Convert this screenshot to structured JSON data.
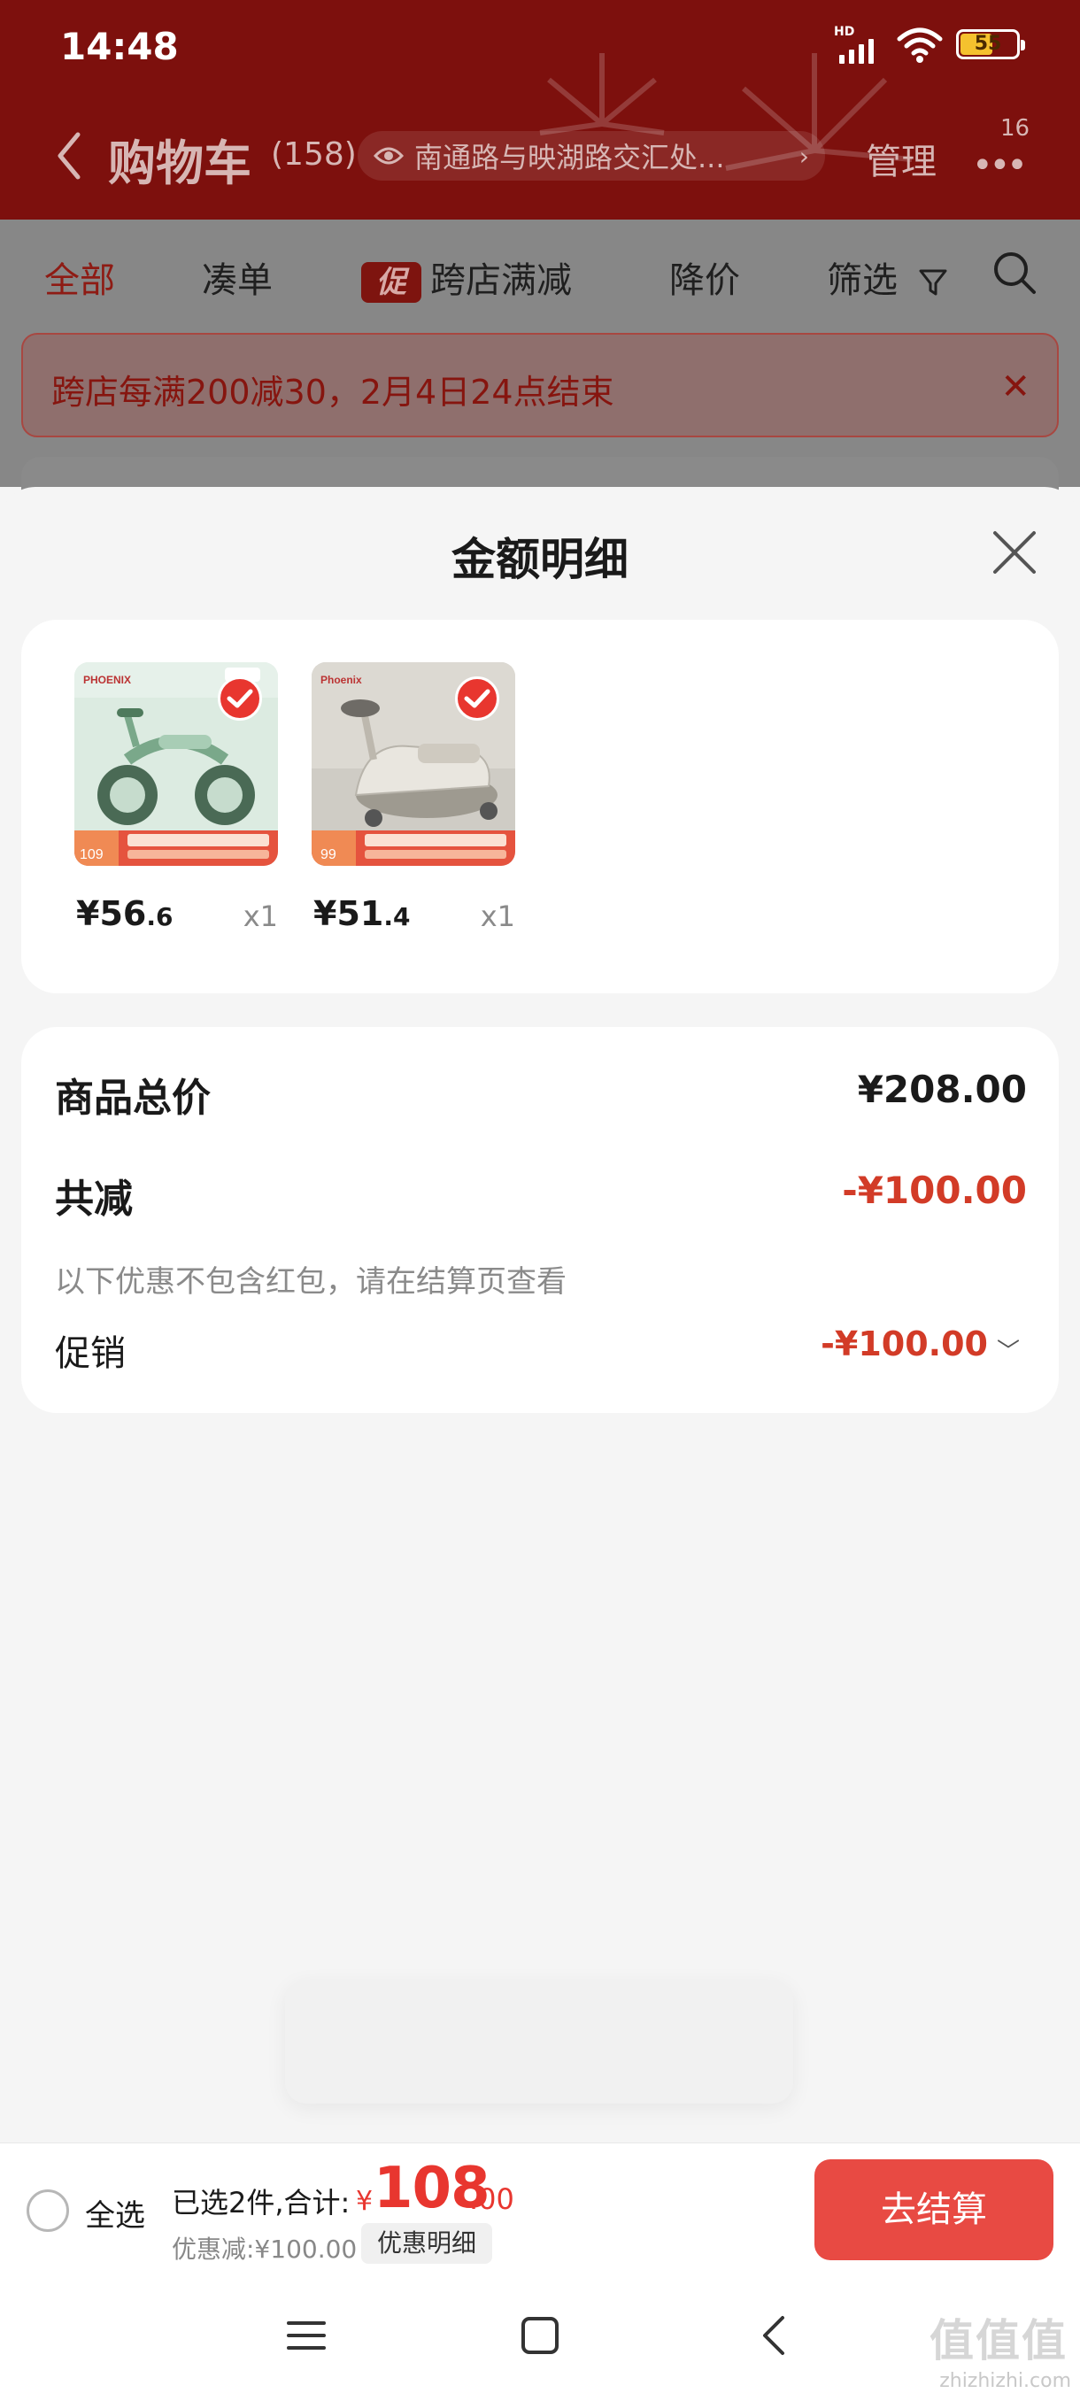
{
  "status_bar": {
    "time": "14:48",
    "signal_label": "HD",
    "battery_level": "55",
    "icons": [
      "signal-icon",
      "wifi-icon",
      "battery-icon"
    ]
  },
  "header": {
    "title": "购物车",
    "count": "(158)",
    "address": "南通路与映湖路交汇处...",
    "manage_label": "管理",
    "more_badge": "16",
    "icons": [
      "back-chevron-icon",
      "eye-icon",
      "chevron-right-icon",
      "more-icon"
    ]
  },
  "tabs": {
    "items": [
      {
        "label": "全部",
        "active": true
      },
      {
        "label": "凑单",
        "active": false
      },
      {
        "label": "跨店满减",
        "badge": "促",
        "active": false
      },
      {
        "label": "降价",
        "active": false
      },
      {
        "label": "筛选",
        "active": false
      }
    ],
    "icons": [
      "filter-icon",
      "search-icon"
    ]
  },
  "promo_banner": {
    "text": "跨店每满200减30，2月4日24点结束",
    "close": "✕"
  },
  "sheet": {
    "title": "金额明细",
    "close_icon": "close-icon",
    "items": [
      {
        "price_int": "¥56",
        "price_dec": ".6",
        "qty": "x1",
        "checked": true,
        "image": "balance-bike-product-image"
      },
      {
        "price_int": "¥51",
        "price_dec": ".4",
        "qty": "x1",
        "checked": true,
        "image": "swing-car-product-image"
      }
    ],
    "summary": {
      "goods_total_label": "商品总价",
      "goods_total_value": "¥208.00",
      "discount_label": "共减",
      "discount_value": "-¥100.00",
      "note": "以下优惠不包含红包，请在结算页查看",
      "promo_label": "促销",
      "promo_value": "-¥100.00"
    }
  },
  "checkout": {
    "select_all": "全选",
    "selected_summary": "已选2件,合计:",
    "yen": "¥",
    "total_int": "108",
    "total_dec": ".00",
    "discount_line": "优惠减:¥100.00",
    "discount_detail_button": "优惠明细",
    "checkout_button": "去结算"
  },
  "colors": {
    "brand_red": "#e84a43",
    "header_dark_red": "#7d100d",
    "discount_red": "#d23b27"
  },
  "watermark": "zhizhizhi.com"
}
